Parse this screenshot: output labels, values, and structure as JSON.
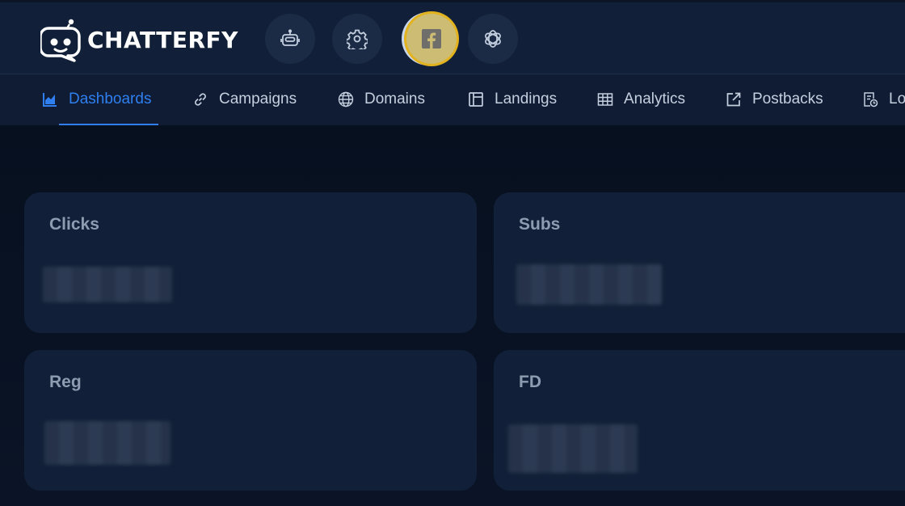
{
  "app": {
    "brand": "CHATTERFY"
  },
  "header": {
    "icon_buttons": [
      {
        "icon": "robot-icon"
      },
      {
        "icon": "gear-icon"
      },
      {
        "icon": "facebook-icon"
      },
      {
        "icon": "openai-icon"
      }
    ]
  },
  "nav": {
    "tabs": [
      {
        "label": "Dashboards",
        "icon": "chart-icon",
        "active": true
      },
      {
        "label": "Campaigns",
        "icon": "link-icon"
      },
      {
        "label": "Domains",
        "icon": "globe-www-icon"
      },
      {
        "label": "Landings",
        "icon": "layout-icon"
      },
      {
        "label": "Analytics",
        "icon": "table-icon"
      },
      {
        "label": "Postbacks",
        "icon": "external-link-icon"
      },
      {
        "label": "Lo",
        "icon": "log-icon"
      }
    ]
  },
  "cards": [
    {
      "title": "Clicks"
    },
    {
      "title": "Subs"
    },
    {
      "title": "Reg"
    },
    {
      "title": "FD"
    }
  ],
  "colors": {
    "accent": "#2f7ff0",
    "highlight": "#e2b21f"
  }
}
